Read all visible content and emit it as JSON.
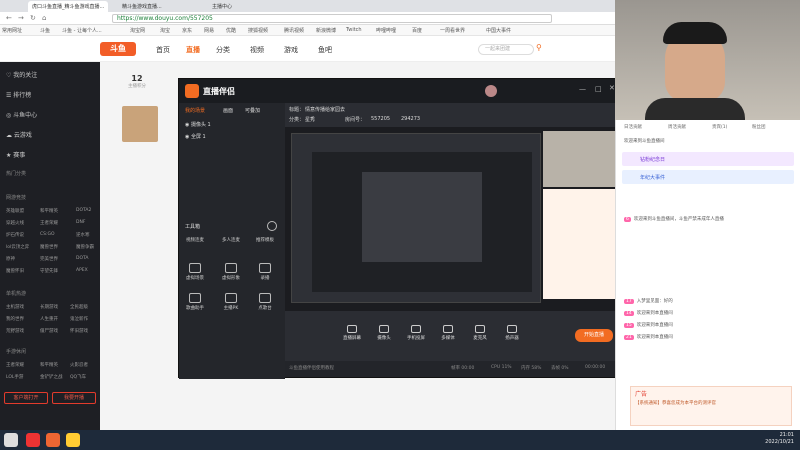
{
  "browser": {
    "tabs": [
      "虎口斗鱼直播_精斗鱼游戏直播...",
      "精斗鱼游戏直播...",
      "主播中心"
    ],
    "url": "https://www.douyu.com/557205",
    "bookmarks": [
      "常用网址",
      "斗鱼",
      "斗鱼 - 让每个人...",
      "淘宝网",
      "淘宝",
      "京东",
      "网易",
      "优酷",
      "搜狐视频",
      "腾讯视频",
      "新浪微博",
      "Twitch",
      "哔哩哔哩",
      "百度",
      "一周看世界",
      "中国大事件"
    ]
  },
  "site": {
    "logo": "斗鱼",
    "nav": [
      "首页",
      "直播",
      "分类",
      "视频",
      "游戏",
      "鱼吧"
    ],
    "active_nav": "直播",
    "search_placeholder": "一起来团建",
    "room_level": "12",
    "room_level_label": "主播积分"
  },
  "sidebar": {
    "items": [
      "我的关注",
      "排行榜",
      "斗鱼中心",
      "云游戏",
      "赛事"
    ],
    "section_hot": "热门分类",
    "section_game": "网游竞技",
    "grid": [
      [
        "英雄联盟",
        "和平精英",
        "DOTA2"
      ],
      [
        "穿越火线",
        "王者荣耀",
        "DNF"
      ],
      [
        "炉石传说",
        "CS:GO",
        "逆水寒"
      ],
      [
        "lol云顶之弈",
        "魔兽世界",
        "魔兽争霸"
      ],
      [
        "原神",
        "完美世界",
        "DOTA"
      ],
      [
        "魔兽怀旧",
        "守望先锋",
        "APEX"
      ]
    ],
    "section_mobile": "单机热游",
    "grid2": [
      [
        "主机游戏",
        "长期游戏",
        "全民超级"
      ],
      [
        "我的世界",
        "人生重开",
        "鬼泣新作"
      ],
      [
        "荒野游戏",
        "僵尸游戏",
        "怀旧游戏"
      ]
    ],
    "section_hand": "手游休闲",
    "grid3": [
      [
        "王者荣耀",
        "和平精英",
        "火影忍者"
      ],
      [
        "LOL手游",
        "金铲铲之战",
        "QQ飞车"
      ]
    ],
    "btn_client": "客户端打开",
    "btn_live": "我要开播"
  },
  "dialog": {
    "title": "直播伴侣",
    "left_tabs": [
      "我的场景",
      "画面",
      "可叠加"
    ],
    "scenes": [
      "摄像头 1",
      "全屏 1"
    ],
    "tools_label": "工具箱",
    "tools": [
      "视频连麦",
      "多人连麦",
      "推荐模板",
      "虚拟场景",
      "虚拟形象",
      "录播",
      "歌曲助手",
      "主播PK",
      "点歌台"
    ],
    "tools_selected": [
      "视频连麦",
      "多人连麦",
      "推荐模板",
      "虚拟场景",
      "虚拟形象",
      "录播"
    ],
    "room_title_label": "标题：",
    "room_title": "情意传播给家园去",
    "category_label": "分类：",
    "category": "星秀",
    "room_id_label": "房间号：",
    "room_id": "557205",
    "fans": "294273",
    "bottom_actions": [
      "直播屏幕",
      "摄像头",
      "手机投屏",
      "多媒体",
      "麦克风",
      "扬声器"
    ],
    "start_label": "开始直播",
    "status_left": "斗鱼直播伴侣使用教程",
    "status_items": [
      "帧率 00:00",
      "CPU 11%",
      "内存 58%",
      "丢帧 0%",
      "00:00:00"
    ]
  },
  "chat": {
    "tabs": [
      "日活贡献",
      "周活贡献",
      "贵宾(1)",
      "粉丝团"
    ],
    "notice": "欢迎来到斗鱼直播间",
    "banners": [
      "钻粉纪念日",
      "年纪大事件"
    ],
    "messages": [
      {
        "level": "6",
        "text": "欢迎来到斗鱼直播间，斗鱼严禁未成年人直播"
      },
      {
        "level": "17",
        "text": "入梦里见面：好的"
      },
      {
        "level": "14",
        "text": "欢迎来到本直播间"
      },
      {
        "level": "15",
        "text": "欢迎来到本直播间"
      },
      {
        "level": "21",
        "text": "欢迎来到本直播间"
      }
    ],
    "ad_title": "广告",
    "ad_text": "【系统通知】恭喜您成为本平台的测评官"
  },
  "taskbar": {
    "time": "21:01",
    "date": "2022/10/21"
  }
}
